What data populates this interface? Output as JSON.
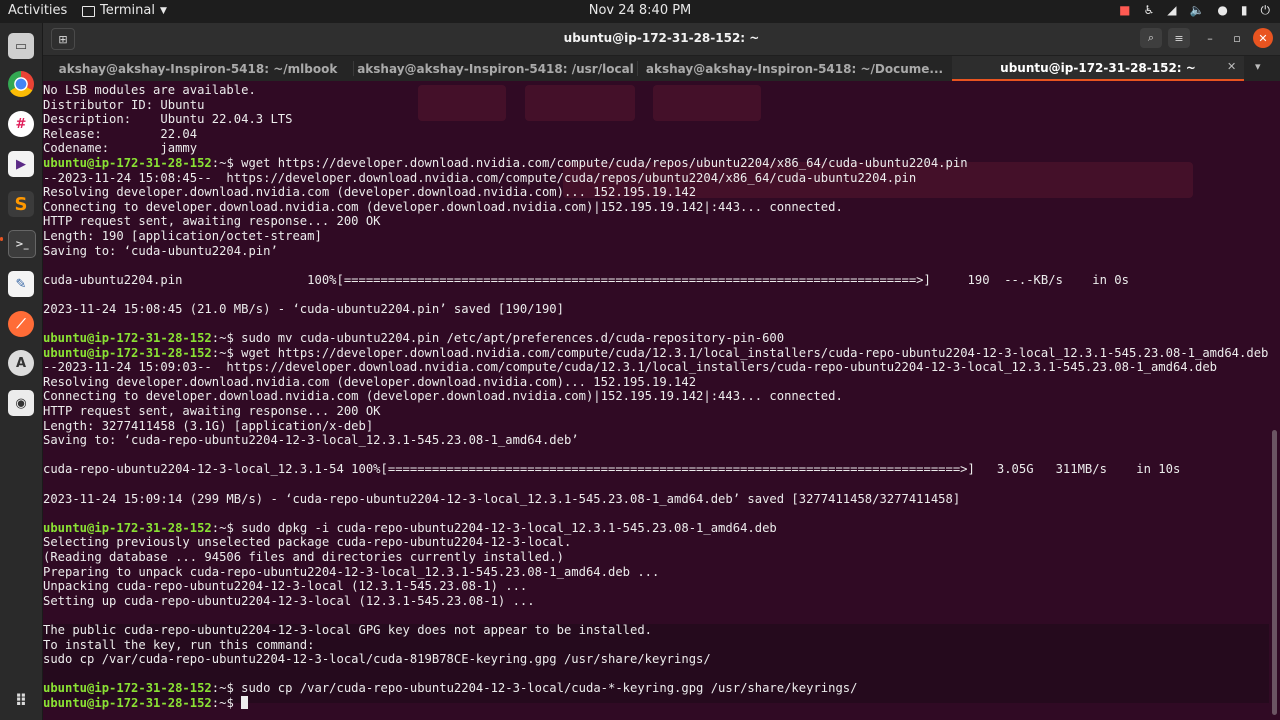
{
  "topbar": {
    "activities": "Activities",
    "app_name": "Terminal",
    "clock": "Nov 24  8:40 PM",
    "tray_icons": [
      "record-icon",
      "accessibility-icon",
      "wifi-icon",
      "microphone-icon",
      "battery-icon",
      "power-icon"
    ]
  },
  "dock": {
    "items": [
      "files-icon",
      "chrome-icon",
      "slack-icon",
      "video-app-icon",
      "sublime-icon",
      "terminal-icon",
      "text-editor-icon",
      "postman-icon",
      "settings-icon",
      "screenshot-icon"
    ],
    "apps_grid": "show-applications-icon"
  },
  "window": {
    "title": "ubuntu@ip-172-31-28-152: ~",
    "tabs": [
      {
        "label": "akshay@akshay-Inspiron-5418: ~/mlbook",
        "active": false
      },
      {
        "label": "akshay@akshay-Inspiron-5418: /usr/local",
        "active": false
      },
      {
        "label": "akshay@akshay-Inspiron-5418: ~/Docume...",
        "active": false
      },
      {
        "label": "ubuntu@ip-172-31-28-152: ~",
        "active": true
      }
    ]
  },
  "terminal": {
    "prompt": "ubuntu@ip-172-31-28-152",
    "prompt_suffix": ":~$ ",
    "lines": [
      "No LSB modules are available.",
      "Distributor ID:\tUbuntu",
      "Description:\tUbuntu 22.04.3 LTS",
      "Release:\t22.04",
      "Codename:\tjammy",
      "$ wget https://developer.download.nvidia.com/compute/cuda/repos/ubuntu2204/x86_64/cuda-ubuntu2204.pin",
      "--2023-11-24 15:08:45--  https://developer.download.nvidia.com/compute/cuda/repos/ubuntu2204/x86_64/cuda-ubuntu2204.pin",
      "Resolving developer.download.nvidia.com (developer.download.nvidia.com)... 152.195.19.142",
      "Connecting to developer.download.nvidia.com (developer.download.nvidia.com)|152.195.19.142|:443... connected.",
      "HTTP request sent, awaiting response... 200 OK",
      "Length: 190 [application/octet-stream]",
      "Saving to: ‘cuda-ubuntu2204.pin’",
      "",
      "cuda-ubuntu2204.pin                 100%[==============================================================================>]     190  --.-KB/s    in 0s",
      "",
      "2023-11-24 15:08:45 (21.0 MB/s) - ‘cuda-ubuntu2204.pin’ saved [190/190]",
      "",
      "$ sudo mv cuda-ubuntu2204.pin /etc/apt/preferences.d/cuda-repository-pin-600",
      "$ wget https://developer.download.nvidia.com/compute/cuda/12.3.1/local_installers/cuda-repo-ubuntu2204-12-3-local_12.3.1-545.23.08-1_amd64.deb",
      "--2023-11-24 15:09:03--  https://developer.download.nvidia.com/compute/cuda/12.3.1/local_installers/cuda-repo-ubuntu2204-12-3-local_12.3.1-545.23.08-1_amd64.deb",
      "Resolving developer.download.nvidia.com (developer.download.nvidia.com)... 152.195.19.142",
      "Connecting to developer.download.nvidia.com (developer.download.nvidia.com)|152.195.19.142|:443... connected.",
      "HTTP request sent, awaiting response... 200 OK",
      "Length: 3277411458 (3.1G) [application/x-deb]",
      "Saving to: ‘cuda-repo-ubuntu2204-12-3-local_12.3.1-545.23.08-1_amd64.deb’",
      "",
      "cuda-repo-ubuntu2204-12-3-local_12.3.1-54 100%[==============================================================================>]   3.05G   311MB/s    in 10s",
      "",
      "2023-11-24 15:09:14 (299 MB/s) - ‘cuda-repo-ubuntu2204-12-3-local_12.3.1-545.23.08-1_amd64.deb’ saved [3277411458/3277411458]",
      "",
      "$ sudo dpkg -i cuda-repo-ubuntu2204-12-3-local_12.3.1-545.23.08-1_amd64.deb",
      "Selecting previously unselected package cuda-repo-ubuntu2204-12-3-local.",
      "(Reading database ... 94506 files and directories currently installed.)",
      "Preparing to unpack cuda-repo-ubuntu2204-12-3-local_12.3.1-545.23.08-1_amd64.deb ...",
      "Unpacking cuda-repo-ubuntu2204-12-3-local (12.3.1-545.23.08-1) ...",
      "Setting up cuda-repo-ubuntu2204-12-3-local (12.3.1-545.23.08-1) ...",
      "",
      "The public cuda-repo-ubuntu2204-12-3-local GPG key does not appear to be installed.",
      "To install the key, run this command:",
      "sudo cp /var/cuda-repo-ubuntu2204-12-3-local/cuda-819B78CE-keyring.gpg /usr/share/keyrings/",
      "",
      "$ sudo cp /var/cuda-repo-ubuntu2204-12-3-local/cuda-*-keyring.gpg /usr/share/keyrings/",
      "$ "
    ]
  },
  "colors": {
    "terminal_bg": "#300a24",
    "prompt": "#8ae234",
    "text": "#ececec",
    "accent": "#e95420"
  }
}
